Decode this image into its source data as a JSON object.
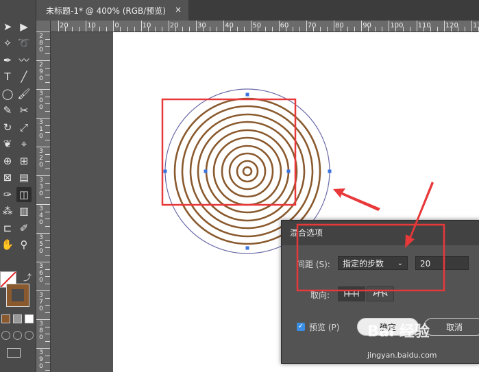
{
  "tab": {
    "title": "未标题-1* @ 400% (RGB/预览)",
    "close": "×"
  },
  "hruler": {
    "labels": [
      "20",
      "10",
      "0",
      "10",
      "20",
      "30",
      "40",
      "50",
      "60",
      "70",
      "80",
      "90",
      "100",
      "110",
      "120",
      "130"
    ]
  },
  "vruler": {
    "labels": [
      "280",
      "290",
      "300",
      "310",
      "320",
      "330",
      "340",
      "350",
      "360",
      "370",
      "380",
      "390"
    ]
  },
  "toolbar": {
    "tools": [
      {
        "icon": "selection-icon",
        "glyph": "➤"
      },
      {
        "icon": "direct-selection-icon",
        "glyph": "▶"
      },
      {
        "icon": "magic-wand-icon",
        "glyph": "✧"
      },
      {
        "icon": "lasso-icon",
        "glyph": "➰"
      },
      {
        "icon": "pen-icon",
        "glyph": "✒"
      },
      {
        "icon": "curvature-icon",
        "glyph": "〰"
      },
      {
        "icon": "type-icon",
        "glyph": "T"
      },
      {
        "icon": "line-icon",
        "glyph": "╱"
      },
      {
        "icon": "ellipse-icon",
        "glyph": "◯"
      },
      {
        "icon": "paintbrush-icon",
        "glyph": "🖌"
      },
      {
        "icon": "shaper-icon",
        "glyph": "✎"
      },
      {
        "icon": "scissors-icon",
        "glyph": "✂"
      },
      {
        "icon": "rotate-icon",
        "glyph": "↻"
      },
      {
        "icon": "scale-icon",
        "glyph": "⤢"
      },
      {
        "icon": "warp-icon",
        "glyph": "❦"
      },
      {
        "icon": "free-transform-icon",
        "glyph": "⌖"
      },
      {
        "icon": "shape-builder-icon",
        "glyph": "⊕"
      },
      {
        "icon": "perspective-icon",
        "glyph": "⊞"
      },
      {
        "icon": "mesh-icon",
        "glyph": "⊠"
      },
      {
        "icon": "gradient-icon",
        "glyph": "▤"
      },
      {
        "icon": "eyedropper-icon",
        "glyph": "✑"
      },
      {
        "icon": "blend-icon",
        "glyph": "◫"
      },
      {
        "icon": "symbol-sprayer-icon",
        "glyph": "⁂"
      },
      {
        "icon": "column-graph-icon",
        "glyph": "▥"
      },
      {
        "icon": "artboard-icon",
        "glyph": "⊏"
      },
      {
        "icon": "slice-icon",
        "glyph": "✐"
      },
      {
        "icon": "hand-icon",
        "glyph": "✋"
      },
      {
        "icon": "zoom-icon",
        "glyph": "⚲"
      }
    ],
    "fill_color": "#ffffff",
    "stroke_color": "#8a5a2e"
  },
  "dialog": {
    "title": "混合选项",
    "spacing_label": "间距 (S):",
    "spacing_value": "指定的步数",
    "steps_value": "20",
    "orientation_label": "取向:",
    "preview_label": "预览 (P)",
    "preview_check": "✓",
    "ok_label": "确定",
    "cancel_label": "取消"
  },
  "watermark": {
    "main": "Bai 经验",
    "sub": "jingyan.baidu.com"
  },
  "colors": {
    "ring": "#8a5a2e",
    "outer_path": "#6a6aa8",
    "anchor": "#3b74e0",
    "annotation": "#e8383a"
  }
}
